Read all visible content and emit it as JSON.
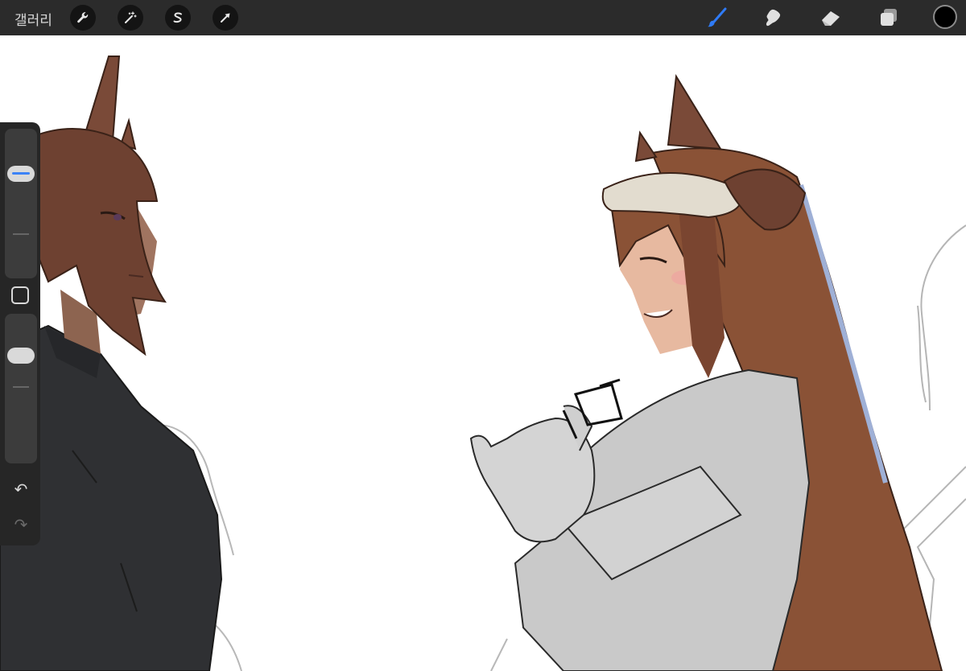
{
  "topbar": {
    "gallery_label": "갤러리",
    "left_tools": [
      {
        "icon": "wrench-icon",
        "name": "actions"
      },
      {
        "icon": "magic-wand-icon",
        "name": "adjustments"
      },
      {
        "icon": "selection-s-icon",
        "name": "selection"
      },
      {
        "icon": "arrow-cursor-icon",
        "name": "transform"
      }
    ],
    "right_tools": [
      {
        "icon": "brush-icon",
        "name": "brush",
        "active": true
      },
      {
        "icon": "smudge-icon",
        "name": "smudge"
      },
      {
        "icon": "eraser-icon",
        "name": "eraser"
      },
      {
        "icon": "layers-icon",
        "name": "layers"
      }
    ],
    "color": "#000000",
    "accent": "#2f7bf6"
  },
  "sidebar": {
    "brush_size_level": 0.28,
    "opacity_level": 0.75,
    "icons": [
      "modify-square-icon",
      "undo-icon",
      "redo-icon"
    ]
  },
  "canvas": {
    "background": "#ffffff",
    "figures": [
      "left-character",
      "right-character"
    ]
  }
}
